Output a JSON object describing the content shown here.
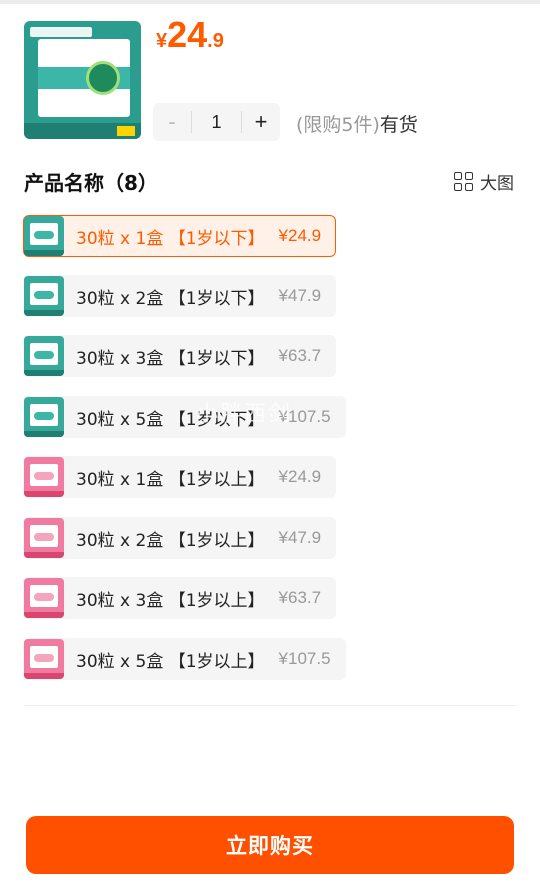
{
  "product": {
    "price_currency": "¥",
    "price_integer": "24",
    "price_decimal": ".9",
    "quantity": "1",
    "stepper_minus": "-",
    "stepper_plus": "+",
    "purchase_limit": "(限购5件)",
    "stock_status": "有货"
  },
  "section": {
    "title": "产品名称（8）",
    "view_toggle_label": "大图"
  },
  "options": [
    {
      "label": "30粒 x 1盒 【1岁以下】",
      "price": "¥24.9",
      "theme": "teal",
      "selected": true
    },
    {
      "label": "30粒 x 2盒 【1岁以下】",
      "price": "¥47.9",
      "theme": "teal",
      "selected": false
    },
    {
      "label": "30粒 x 3盒 【1岁以下】",
      "price": "¥63.7",
      "theme": "teal",
      "selected": false
    },
    {
      "label": "30粒 x 5盒 【1岁以下】",
      "price": "¥107.5",
      "theme": "teal",
      "selected": false
    },
    {
      "label": "30粒 x 1盒 【1岁以上】",
      "price": "¥24.9",
      "theme": "pink",
      "selected": false
    },
    {
      "label": "30粒 x 2盒 【1岁以上】",
      "price": "¥47.9",
      "theme": "pink",
      "selected": false
    },
    {
      "label": "30粒 x 3盒 【1岁以上】",
      "price": "¥63.7",
      "theme": "pink",
      "selected": false
    },
    {
      "label": "30粒 x 5盒 【1岁以上】",
      "price": "¥107.5",
      "theme": "pink",
      "selected": false
    }
  ],
  "watermark": "小胖西剑",
  "buy_button_label": "立即购买",
  "colors": {
    "accent": "#ff5a00",
    "buy_button": "#ff5000",
    "teal_package": "#37a99b",
    "pink_package": "#f07aa0"
  },
  "icons": {
    "view_toggle": "grid-icon"
  }
}
